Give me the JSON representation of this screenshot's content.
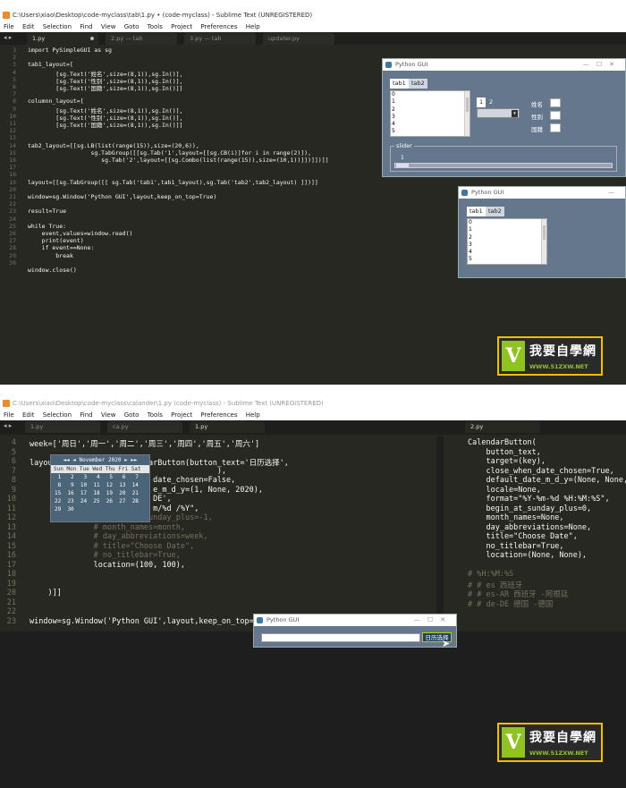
{
  "top": {
    "title": "C:\\Users\\xiao\\Desktop\\code-myclass\\tab\\1.py • (code-myclass) - Sublime Text (UNREGISTERED)",
    "menu": [
      "File",
      "Edit",
      "Selection",
      "Find",
      "View",
      "Goto",
      "Tools",
      "Project",
      "Preferences",
      "Help"
    ],
    "tabs": [
      "1.py",
      "2.py — tab",
      "3.py — tab",
      "updater.py"
    ],
    "line_numbers": [
      "1",
      "2",
      "3",
      "4",
      "5",
      "6",
      "7",
      "8",
      "9",
      "10",
      "11",
      "12",
      "13",
      "14",
      "15",
      "16",
      "17",
      "18",
      "19",
      "20",
      "21",
      "22",
      "23",
      "24",
      "25",
      "26",
      "27",
      "28",
      "29",
      "30"
    ],
    "code": [
      "import PySimpleGUI as sg",
      "",
      "tab1_layout=[",
      "        [sg.Text('姓名',size=(8,1)),sg.In()],",
      "        [sg.Text('性别',size=(8,1)),sg.In()],",
      "        [sg.Text('国籍',size=(8,1)),sg.In()]]",
      "",
      "columnn_layout=[",
      "        [sg.Text('姓名',size=(8,1)),sg.In()],",
      "        [sg.Text('性别',size=(8,1)),sg.In()],",
      "        [sg.Text('国籍',size=(8,1)),sg.In()]]",
      "",
      "",
      "tab2_layout=[[sg.LB(list(range(15)),size=(20,6)),",
      "                  sg.TabGroup([[sg.Tab('1',layout=[[sg.CB(i)]for i in range(2)]),",
      "                     sg.Tab('2',layout=[[sg.Combo(list(range(15)),size=(10,1))]])]])]]",
      "",
      "",
      "layout=[[sg.TabGroup([[ sg.Tab('tab1',tab1_layout),sg.Tab('tab2',tab2_layout) ]])]]",
      "",
      "window=sg.Window('Python GUI',layout,keep_on_top=True)",
      "",
      "result=True",
      "",
      "while True:",
      "    event,values=window.read()",
      "    print(event)",
      "    if event==None:",
      "        break",
      "",
      "window.close()"
    ],
    "gui1": {
      "title": "Python GUI",
      "tabs": [
        "tab1",
        "tab2"
      ],
      "list": [
        "0",
        "1",
        "2",
        "3",
        "4",
        "5"
      ],
      "subtabs": [
        "1",
        "2"
      ],
      "labels": [
        "姓名",
        "性别",
        "国籍"
      ],
      "frame_title": "slider",
      "slider_value": "1"
    },
    "gui2": {
      "title": "Python GUI",
      "tabs": [
        "tab1",
        "tab2"
      ],
      "list": [
        "0",
        "1",
        "2",
        "3",
        "4",
        "5"
      ]
    }
  },
  "bottom": {
    "title": "C:\\Users\\xiao\\Desktop\\code-myclass\\calander\\1.py (code-myclass) - Sublime Text (UNREGISTERED)",
    "menu": [
      "File",
      "Edit",
      "Selection",
      "Find",
      "View",
      "Goto",
      "Tools",
      "Project",
      "Preferences",
      "Help"
    ],
    "tabs_left": [
      "1.py",
      "ca.py",
      "1.py"
    ],
    "tabs_right": [
      "2.py"
    ],
    "line_numbers": [
      "4",
      "5",
      "6",
      "7",
      "8",
      "9",
      "10",
      "11",
      "12",
      "13",
      "14",
      "15",
      "16",
      "17",
      "18",
      "19",
      "20",
      "21",
      "22",
      "23"
    ],
    "code_lines": [
      "week=['周日','周一','周二','周三','周四','周五','周六']",
      "",
      "layout=[[sg.In(),sg.CalendarButton(button_text='日历选择',",
      "                                         ),",
      "                           date_chosen=False,",
      "                           e_m_d_y=(1, None, 2020),",
      "                           DE',",
      "                           m/%d /%Y\",",
      "              # begin_at_sunday_plus=-1,",
      "              # month_names=month,",
      "              # day_abbreviations=week,",
      "              # title=\"Choose Date\",",
      "              # no_titlebar=True,",
      "              location=(100, 100),",
      "",
      "",
      "    )]]",
      "",
      "",
      "window=sg.Window('Python GUI',layout,keep_on_top=True)"
    ],
    "right_code": [
      "CalendarButton(",
      "    button_text,",
      "    target=(key),",
      "    close_when_date_chosen=True,",
      "    default_date_m_d_y=(None, None, N",
      "    locale=None,",
      "    format=\"%Y-%m-%d %H:%M:%S\",",
      "    begin_at_sunday_plus=0,",
      "    month_names=None,",
      "    day_abbreviations=None,",
      "    title=\"Choose Date\",",
      "    no_titlebar=True,",
      "    location=(None, None),",
      "",
      "# %H:%M:%S",
      "# # es 西班牙",
      "# # es-AR 西班牙 -阿根廷",
      "# # de-DE 德国 -德国"
    ],
    "calendar": {
      "header": "◄◄ ◄   November 2020   ► ►►",
      "dow": "Sun Mon Tue Wed Thu Fri Sat",
      "rows": [
        " 1   2   3   4   5   6   7",
        " 8   9  10  11  12  13  14",
        "15  16  17  18  19  20  21",
        "22  23  24  25  26  27  28",
        "29  30"
      ]
    },
    "gui": {
      "title": "Python GUI",
      "button": "日历选择"
    }
  },
  "logo": {
    "text": "我要自學網",
    "url": "WWW.51ZXW.NET"
  }
}
